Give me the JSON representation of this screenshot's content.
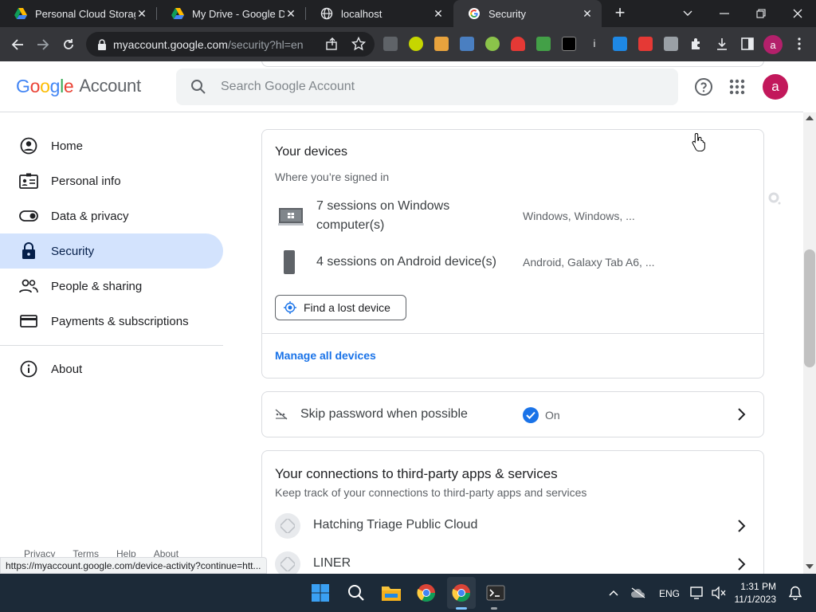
{
  "browser": {
    "tabs": [
      {
        "title": "Personal Cloud Storag",
        "icon": "google-drive-icon"
      },
      {
        "title": "My Drive - Google Dri",
        "icon": "google-drive-icon"
      },
      {
        "title": "localhost",
        "icon": "globe-icon"
      },
      {
        "title": "Security",
        "icon": "google-g-icon"
      }
    ],
    "url_host": "myaccount.google.com",
    "url_rest": "/security?hl=en",
    "profile_initial": "a"
  },
  "header": {
    "logo_google": "Google",
    "logo_account": "Account",
    "search_placeholder": "Search Google Account",
    "avatar_initial": "a"
  },
  "sidebar": {
    "items": [
      {
        "label": "Home",
        "icon": "home-icon"
      },
      {
        "label": "Personal info",
        "icon": "id-card-icon"
      },
      {
        "label": "Data & privacy",
        "icon": "toggle-icon"
      },
      {
        "label": "Security",
        "icon": "lock-icon"
      },
      {
        "label": "People & sharing",
        "icon": "people-icon"
      },
      {
        "label": "Payments & subscriptions",
        "icon": "credit-card-icon"
      },
      {
        "label": "About",
        "icon": "info-icon"
      }
    ],
    "footer": [
      "Privacy",
      "Terms",
      "Help",
      "About"
    ]
  },
  "devices": {
    "title": "Your devices",
    "subtitle": "Where you’re signed in",
    "rows": [
      {
        "name_line1": "7 sessions on Windows",
        "name_line2": "computer(s)",
        "detail": "Windows, Windows, ..."
      },
      {
        "name_line1": "4 sessions on Android device(s)",
        "name_line2": "",
        "detail": "Android, Galaxy Tab A6, ..."
      }
    ],
    "find_button": "Find a lost device",
    "manage_link": "Manage all devices"
  },
  "skip_password": {
    "label": "Skip password when possible",
    "status": "On"
  },
  "connections": {
    "title": "Your connections to third-party apps & services",
    "subtitle": "Keep track of your connections to third-party apps and services",
    "apps": [
      "Hatching Triage Public Cloud",
      "LINER"
    ]
  },
  "status_url": "https://myaccount.google.com/device-activity?continue=htt...",
  "taskbar": {
    "language": "ENG",
    "time": "1:31 PM",
    "date": "11/1/2023"
  },
  "colors": {
    "accent_blue": "#1a73e8",
    "active_nav_bg": "#d3e3fd",
    "avatar": "#c2185b"
  }
}
